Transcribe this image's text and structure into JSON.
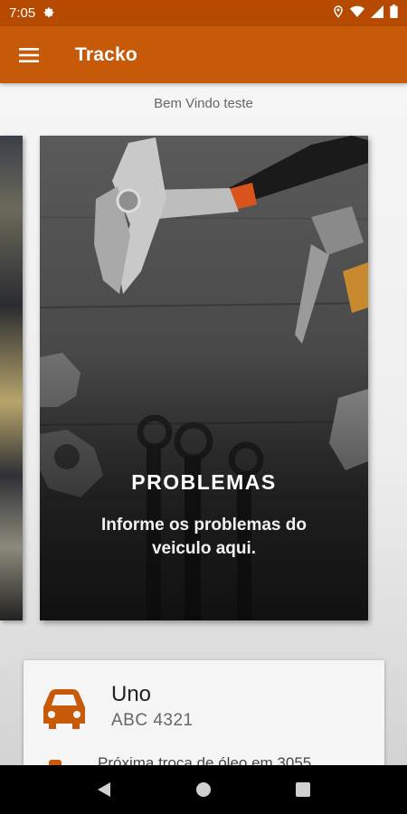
{
  "status_bar": {
    "time": "7:05",
    "icons": [
      "settings-icon",
      "location-icon",
      "wifi-icon",
      "signal-icon",
      "battery-icon"
    ]
  },
  "app_bar": {
    "title": "Tracko",
    "menu_icon": "menu-icon"
  },
  "welcome_text": "Bem Vindo teste",
  "carousel": {
    "cards": [
      {
        "title": "PROBLEMAS",
        "description": "Informe os problemas do veiculo aqui."
      }
    ]
  },
  "vehicle": {
    "name": "Uno",
    "plate": "ABC 4321",
    "info": "Próxima troca de óleo em 3055"
  },
  "colors": {
    "primary": "#c65a08",
    "primary_dark": "#b54a00"
  },
  "nav_bar": {
    "buttons": [
      "back-icon",
      "home-icon",
      "recents-icon"
    ]
  }
}
